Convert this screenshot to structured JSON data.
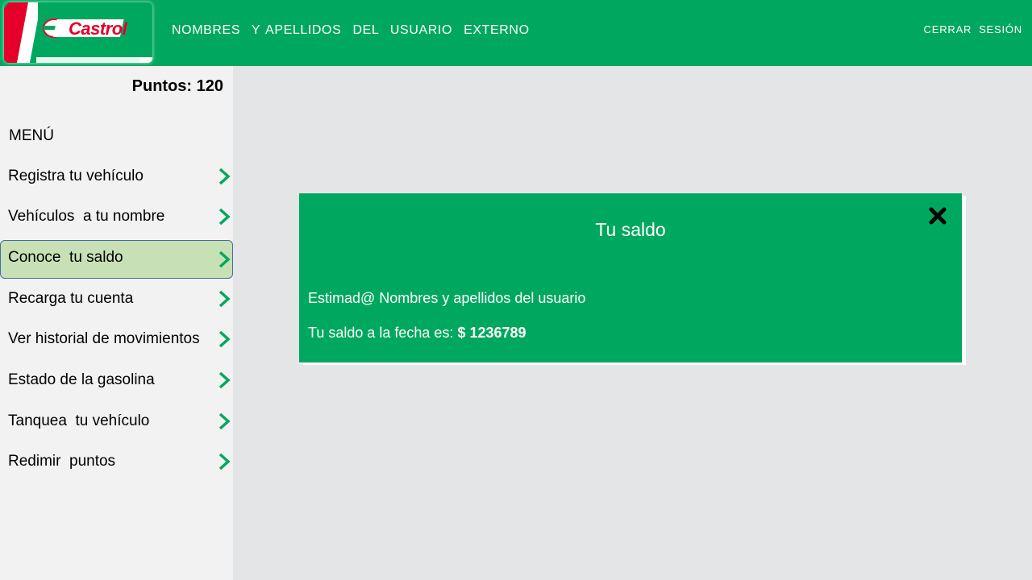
{
  "header": {
    "brand": "Castrol",
    "user_name": "NOMBRES  Y APELLIDOS  DEL  USUARIO  EXTERNO",
    "logout_label": "CERRAR  SESIÓN"
  },
  "sidebar": {
    "points": "Puntos: 120",
    "menu_title": "MENÚ",
    "items": [
      {
        "label": "Registra tu vehículo",
        "active": false
      },
      {
        "label": "Vehículos  a tu nombre",
        "active": false
      },
      {
        "label": "Conoce  tu saldo",
        "active": true
      },
      {
        "label": "Recarga tu cuenta",
        "active": false
      },
      {
        "label": "Ver historial de movimientos",
        "active": false
      },
      {
        "label": "Estado de la gasolina",
        "active": false
      },
      {
        "label": "Tanquea  tu vehículo",
        "active": false
      },
      {
        "label": "Redimir  puntos",
        "active": false
      }
    ]
  },
  "dialog": {
    "title": "Tu saldo",
    "greeting": "Estimad@ Nombres y apellidos del usuario",
    "balance_label": "Tu saldo a la fecha es:",
    "balance_value": "$ 1236789"
  },
  "colors": {
    "brand_green": "#00a85f",
    "brand_red": "#e4002b",
    "active_item": "#c8e0b5",
    "chevron": "#00a85f"
  },
  "icons": {
    "close": "close-icon",
    "menu_arrow": "chevron-right-icon"
  }
}
